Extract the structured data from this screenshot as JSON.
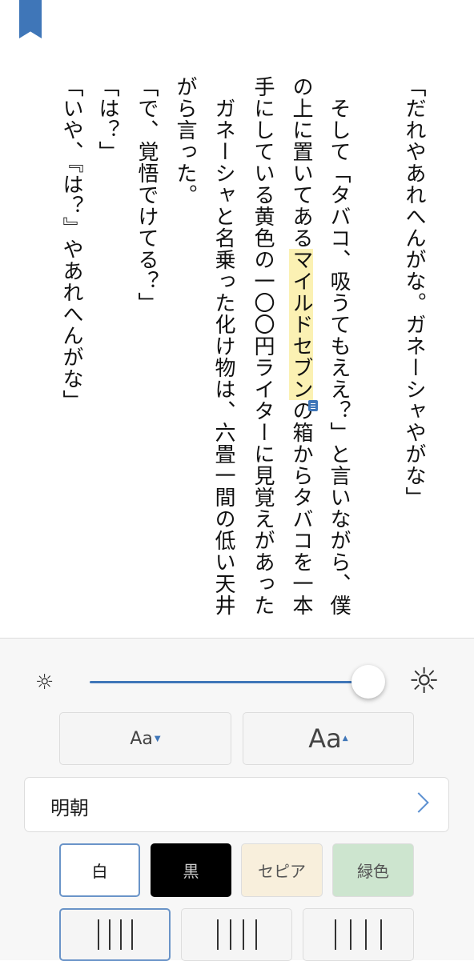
{
  "book": {
    "columns": [
      {
        "text": "「だれやあれへんがな。ガネーシャやがな」"
      },
      {
        "text": ""
      },
      {
        "text": "　そして「タバコ、吸うてもええ？」と言いながら、僕"
      },
      {
        "pre": "の上に置いてある",
        "highlight": "マイルドセブン",
        "post": "の箱からタバコを一本"
      },
      {
        "text": "手にしている黄色の一〇〇円ライターに見覚えがあった"
      },
      {
        "text": "　ガネーシャと名乗った化け物は、六畳一間の低い天井"
      },
      {
        "text": "がら言った。"
      },
      {
        "text": "「で、覚悟でけてる？」"
      },
      {
        "text": "「は？」"
      },
      {
        "text": "「いや、『は？』やあれへんがな」"
      }
    ]
  },
  "settings": {
    "brightness": 1.0,
    "font_smaller": "Aa",
    "font_larger": "Aa",
    "font_name": "明朝",
    "themes": [
      {
        "label": "白",
        "bg": "#ffffff",
        "fg": "#111111",
        "selected": true
      },
      {
        "label": "黒",
        "bg": "#000000",
        "fg": "#cccccc",
        "selected": false
      },
      {
        "label": "セピア",
        "bg": "#f8efdc",
        "fg": "#555555",
        "selected": false
      },
      {
        "label": "緑色",
        "bg": "#cde5cf",
        "fg": "#555555",
        "selected": false
      }
    ],
    "line_spacing_selected": 0
  },
  "colors": {
    "accent": "#3f76b8",
    "highlight": "#fbf1b3"
  }
}
